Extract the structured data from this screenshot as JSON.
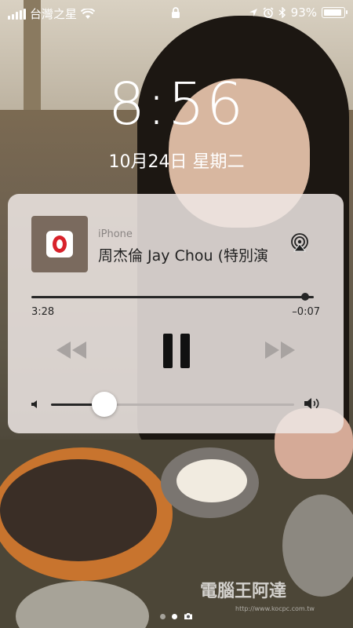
{
  "status_bar": {
    "carrier": "台灣之星",
    "battery_percent": "93%",
    "battery_level": 0.93,
    "icons": [
      "signal-bars-icon",
      "wifi-icon",
      "lock-icon",
      "location-icon",
      "alarm-icon",
      "bluetooth-icon",
      "battery-icon"
    ]
  },
  "lockscreen": {
    "time": "8:56",
    "date": "10月24日 星期二"
  },
  "now_playing": {
    "source": "iPhone",
    "title": "周杰倫 Jay Chou (特別演",
    "elapsed": "3:28",
    "remaining": "–0:07",
    "progress_fraction": 0.97,
    "volume_fraction": 0.22,
    "artwork_icon": "opera-icon",
    "controls": [
      "rewind-icon",
      "pause-icon",
      "fast-forward-icon"
    ]
  },
  "page_indicator": {
    "pages": 2,
    "active_index": 1,
    "camera_icon": "camera-icon"
  },
  "watermark": {
    "text": "電腦王阿達",
    "url": "http://www.kocpc.com.tw"
  }
}
